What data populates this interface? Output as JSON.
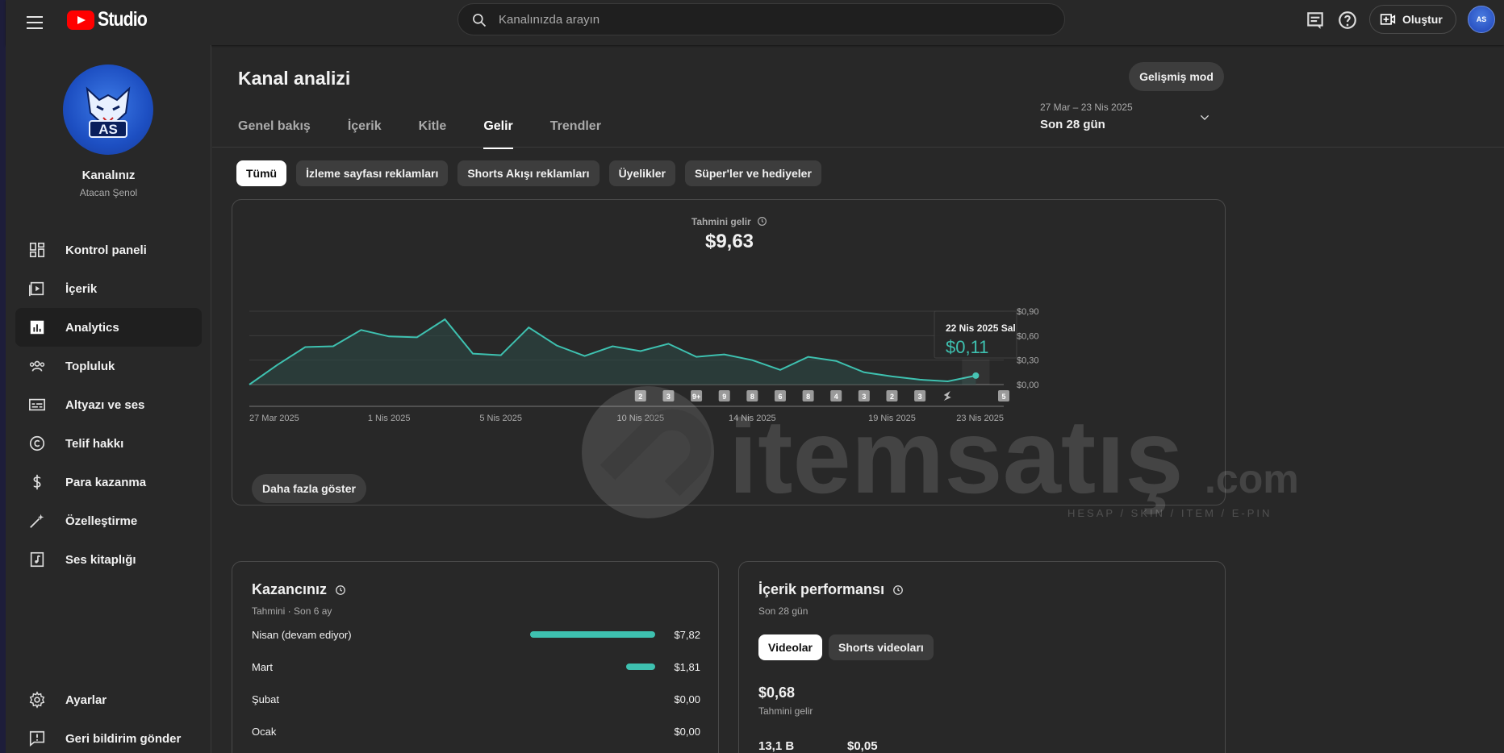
{
  "header": {
    "app_name": "Studio",
    "search_placeholder": "Kanalınızda arayın",
    "create_label": "Oluştur",
    "avatar_text": "AS"
  },
  "sidebar": {
    "channel_name": "Kanalınız",
    "channel_handle": "Atacan Şenol",
    "avatar_text": "AS",
    "items": [
      {
        "label": "Kontrol paneli",
        "icon": "dashboard-icon"
      },
      {
        "label": "İçerik",
        "icon": "content-icon"
      },
      {
        "label": "Analytics",
        "icon": "analytics-icon"
      },
      {
        "label": "Topluluk",
        "icon": "community-icon"
      },
      {
        "label": "Altyazı ve ses",
        "icon": "subtitles-icon"
      },
      {
        "label": "Telif hakkı",
        "icon": "copyright-icon"
      },
      {
        "label": "Para kazanma",
        "icon": "dollar-icon"
      },
      {
        "label": "Özelleştirme",
        "icon": "magic-wand-icon"
      },
      {
        "label": "Ses kitaplığı",
        "icon": "audio-library-icon"
      }
    ],
    "bottom_items": [
      {
        "label": "Ayarlar",
        "icon": "gear-icon"
      },
      {
        "label": "Geri bildirim gönder",
        "icon": "feedback-icon"
      }
    ]
  },
  "main": {
    "title": "Kanal analizi",
    "advanced_mode": "Gelişmiş mod",
    "tabs": [
      "Genel bakış",
      "İçerik",
      "Kitle",
      "Gelir",
      "Trendler"
    ],
    "active_tab": "Gelir",
    "date_range": {
      "sub": "27 Mar – 23 Nis 2025",
      "main": "Son 28 gün"
    },
    "chips": [
      "Tümü",
      "İzleme sayfası reklamları",
      "Shorts Akışı reklamları",
      "Üyelikler",
      "Süper'ler ve hediyeler"
    ],
    "active_chip": "Tümü",
    "metric": {
      "label": "Tahmini gelir",
      "value": "$9,63"
    },
    "show_more": "Daha fazla göster",
    "tooltip": {
      "date": "22 Nis 2025 Sal",
      "value": "$0,11"
    }
  },
  "chart_data": {
    "type": "area",
    "title": "Tahmini gelir",
    "x": [
      "27 Mar 2025",
      "28 Mar 2025",
      "29 Mar 2025",
      "30 Mar 2025",
      "31 Mar 2025",
      "1 Nis 2025",
      "2 Nis 2025",
      "3 Nis 2025",
      "4 Nis 2025",
      "5 Nis 2025",
      "6 Nis 2025",
      "7 Nis 2025",
      "8 Nis 2025",
      "9 Nis 2025",
      "10 Nis 2025",
      "11 Nis 2025",
      "12 Nis 2025",
      "13 Nis 2025",
      "14 Nis 2025",
      "15 Nis 2025",
      "16 Nis 2025",
      "17 Nis 2025",
      "18 Nis 2025",
      "19 Nis 2025",
      "20 Nis 2025",
      "21 Nis 2025",
      "22 Nis 2025"
    ],
    "values": [
      0.0,
      0.24,
      0.46,
      0.47,
      0.67,
      0.59,
      0.58,
      0.8,
      0.38,
      0.36,
      0.7,
      0.48,
      0.35,
      0.47,
      0.41,
      0.5,
      0.34,
      0.37,
      0.3,
      0.18,
      0.34,
      0.29,
      0.15,
      0.1,
      0.06,
      0.04,
      0.11
    ],
    "x_tick_labels": [
      "27 Mar 2025",
      "1 Nis 2025",
      "5 Nis 2025",
      "10 Nis 2025",
      "14 Nis 2025",
      "19 Nis 2025",
      "23 Nis 2025"
    ],
    "x_tick_index": [
      0,
      5,
      9,
      14,
      18,
      23,
      27
    ],
    "y_tick_labels": [
      "$0,90",
      "$0,60",
      "$0,30",
      "$0,00"
    ],
    "y_tick_values": [
      0.9,
      0.6,
      0.3,
      0
    ],
    "ylim": [
      0,
      0.9
    ],
    "highlight_index": 26,
    "markers": [
      {
        "index": 14,
        "label": "2"
      },
      {
        "index": 15,
        "label": "3"
      },
      {
        "index": 16,
        "label": "9+"
      },
      {
        "index": 17,
        "label": "9"
      },
      {
        "index": 18,
        "label": "8"
      },
      {
        "index": 19,
        "label": "6"
      },
      {
        "index": 20,
        "label": "8"
      },
      {
        "index": 21,
        "label": "4"
      },
      {
        "index": 22,
        "label": "3"
      },
      {
        "index": 23,
        "label": "2"
      },
      {
        "index": 24,
        "label": "3"
      },
      {
        "index": 25,
        "label": "shorts-icon"
      },
      {
        "index": 27,
        "label": "5"
      }
    ],
    "line_color": "#3ec1b0",
    "fill_color": "#2c4744"
  },
  "earnings": {
    "title": "Kazancınız",
    "sub": "Tahmini · Son 6 ay",
    "bar_color": "#3ec1b0",
    "rows": [
      {
        "month": "Nisan (devam ediyor)",
        "value": "$7,82",
        "amount": 7.82
      },
      {
        "month": "Mart",
        "value": "$1,81",
        "amount": 1.81
      },
      {
        "month": "Şubat",
        "value": "$0,00",
        "amount": 0
      },
      {
        "month": "Ocak",
        "value": "$0,00",
        "amount": 0
      }
    ]
  },
  "performance": {
    "title": "İçerik performansı",
    "sub": "Son 28 gün",
    "chips": [
      "Videolar",
      "Shorts videoları"
    ],
    "active_chip": "Videolar",
    "value": "$0,68",
    "value_label": "Tahmini gelir",
    "stat1": "13,1 B",
    "stat2": "$0,05"
  },
  "watermark": {
    "brand": "itemsatış",
    "tagline": "HESAP / SKIN / ITEM / E-PIN",
    "tld": ".com"
  }
}
